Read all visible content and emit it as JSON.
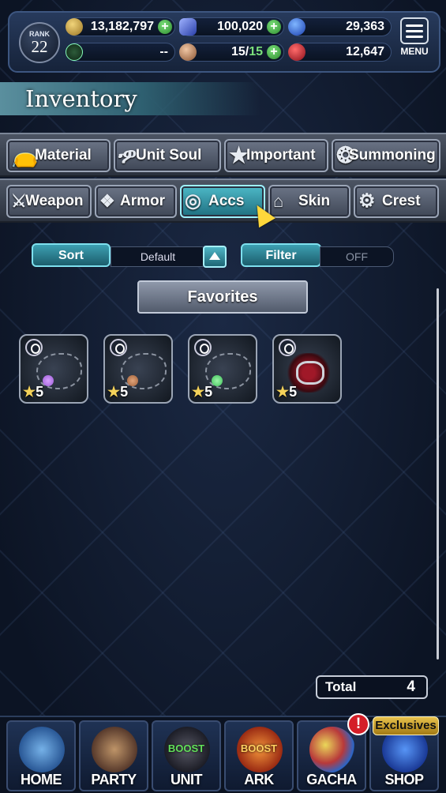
{
  "header": {
    "rank_label": "RANK",
    "rank_value": "22",
    "currencies": [
      {
        "icon": "gil-coin-icon",
        "value": "13,182,797",
        "has_plus": true
      },
      {
        "icon": "crystal-icon",
        "value": "100,020",
        "has_plus": true
      },
      {
        "icon": "blue-orb-icon",
        "value": "29,363",
        "has_plus": false
      },
      {
        "icon": "compass-icon",
        "value": "--",
        "has_plus": false
      },
      {
        "icon": "energy-icon",
        "value": "15/",
        "value2": "15",
        "has_plus": true
      },
      {
        "icon": "red-gem-icon",
        "value": "12,647",
        "has_plus": false
      }
    ],
    "menu_label": "MENU"
  },
  "page_title": "Inventory",
  "category_tabs_row1": [
    {
      "label": "Material",
      "icon": "bag-icon"
    },
    {
      "label": "Unit Soul",
      "icon": "flame-icon"
    },
    {
      "label": "Important",
      "icon": "star-icon"
    },
    {
      "label": "Summoning",
      "icon": "crest-icon"
    }
  ],
  "category_tabs_row2": [
    {
      "label": "Weapon",
      "icon": "sword-icon"
    },
    {
      "label": "Armor",
      "icon": "armor-icon"
    },
    {
      "label": "Accs",
      "icon": "ring-icon",
      "active": true
    },
    {
      "label": "Skin",
      "icon": "hanger-icon"
    },
    {
      "label": "Crest",
      "icon": "gear-icon"
    }
  ],
  "controls": {
    "sort_label": "Sort",
    "sort_value": "Default",
    "filter_label": "Filter",
    "filter_value": "OFF",
    "favorites_label": "Favorites"
  },
  "items": [
    {
      "rarity_star": "★",
      "rarity": "5",
      "gem_color": "#9b5ad6"
    },
    {
      "rarity_star": "★",
      "rarity": "5",
      "gem_color": "#a0603a"
    },
    {
      "rarity_star": "★",
      "rarity": "5",
      "gem_color": "#3fbf5a"
    },
    {
      "rarity_star": "★",
      "rarity": "5",
      "gem_color": "#c0182c"
    }
  ],
  "total": {
    "label": "Total",
    "value": "4"
  },
  "bottom_nav": [
    {
      "label": "HOME"
    },
    {
      "label": "PARTY"
    },
    {
      "label": "UNIT",
      "boost": "BOOST"
    },
    {
      "label": "ARK",
      "boost": "BOOST"
    },
    {
      "label": "GACHA",
      "badge": "!"
    },
    {
      "label": "SHOP",
      "tag": "Exclusives"
    }
  ],
  "colors": {
    "accent": "#3da0b2",
    "active_tab": "#4db8c7",
    "star": "#f4d25a"
  }
}
